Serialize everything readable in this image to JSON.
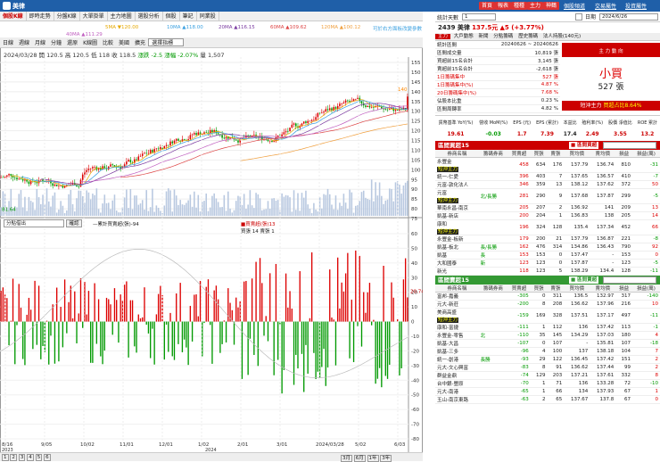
{
  "window": {
    "title": "美律",
    "buttons": [
      "首頁",
      "報表",
      "種種",
      "主力",
      "神鶴"
    ],
    "links": [
      "個股頻道",
      "交易屬性",
      "投資屬性"
    ]
  },
  "menu": [
    "個股K線",
    "即時走勢",
    "分盤K線",
    "大單掛單",
    "主力地圖",
    "選股分析",
    "個股",
    "筆記",
    "同業股"
  ],
  "ma": [
    {
      "label": "5MA",
      "value": "▼120.00",
      "color": "#e6a800"
    },
    {
      "label": "10MA",
      "value": "▲118.00",
      "color": "#3aa0e0"
    },
    {
      "label": "20MA",
      "value": "▲116.15",
      "color": "#7a3aa0"
    },
    {
      "label": "60MA",
      "value": "▲109.62",
      "color": "#d44"
    },
    {
      "label": "120MA",
      "value": "▲100.12",
      "color": "#f0a040"
    },
    {
      "label": "40MA",
      "value": "▲111.29",
      "color": "#c060c0"
    }
  ],
  "ma_note": "可於右方面板改變參數",
  "toolbar": [
    "日線",
    "週線",
    "月線",
    "分鐘",
    "還原",
    "K線圖",
    "比較",
    "美國",
    "擴充",
    "選擇指標"
  ],
  "ohlc": {
    "date": "2024/03/28",
    "open": "開 120.5",
    "high": "高 120.5",
    "low": "低 118",
    "close": "收 118.5",
    "change": "漲跌 -2.5",
    "pct": "漲幅 -2.07%",
    "volume": "量 1,507"
  },
  "price_axis": [
    "155",
    "150",
    "145",
    "140",
    "135",
    "130",
    "125",
    "120",
    "115",
    "110",
    "105",
    "100",
    "95",
    "90",
    "85",
    "80",
    "75"
  ],
  "price_high": "140",
  "price_low": "81.64",
  "lower_selector": "分點借出",
  "lower_btn": "確認",
  "lower_legend": "—累計買賣超(張)-94",
  "lower_legend2": "■買賣超(張)13",
  "lower_legend3": "買張 14  賣張 1",
  "lower_axis": [
    "60",
    "50",
    "40",
    "30",
    "20",
    "10",
    "0",
    "-10",
    "-20",
    "-30",
    "-40",
    "-50",
    "-60",
    "-70",
    "-80"
  ],
  "lower_mark": "20.74",
  "dates": [
    "8/16",
    "9/05",
    "10/02",
    "11/01",
    "12/01",
    "1/02",
    "2/01",
    "3/01",
    "2024/03/28",
    "5/02",
    "6/03"
  ],
  "years": [
    "2023",
    "2024"
  ],
  "bottom": {
    "pages": [
      "1",
      "2",
      "3",
      "4",
      "5",
      "6"
    ],
    "ranges": [
      "3月",
      "6月",
      "1年",
      "3年"
    ]
  },
  "right": {
    "select_label": "統計天數",
    "select_value": "1",
    "date_label": "日期",
    "date_value": "2024/6/26",
    "stock": "2439 美律",
    "price": "137.5元",
    "change": "▲5 (+3.77%)",
    "tabs": [
      "主力",
      "大戶動態",
      "新聞",
      "分點籌碼",
      "歷史籌碼",
      "法人持股(140元)"
    ],
    "stats": [
      [
        "統計區間",
        "20240626 ~ 20240626"
      ],
      [
        "區間成交量",
        "10,819 張"
      ],
      [
        "買超前15名合計",
        "3,145 張"
      ],
      [
        "賣超前15名合計",
        "-2,618 張"
      ],
      [
        "1日籌碼集中",
        "527 張"
      ],
      [
        "1日籌碼集中(%)",
        "4.87 %"
      ],
      [
        "20日籌碼集中(%)",
        "7.68 %"
      ],
      [
        "佔股本比重",
        "0.23 %"
      ],
      [
        "區間周轉率",
        "4.82 %"
      ]
    ],
    "direction_label": "主 力 動 向",
    "direction": "小買",
    "direction_val": "527 張",
    "short_label": "短沖主力",
    "short_val": "買超占比8.64%",
    "fund_headers": [
      "貨幣基準 YoY(%)",
      "營收 MoM(%)",
      "EPS (元)",
      "EPS (累計)",
      "本益比",
      "殖利率(%)",
      "股價 淨值比",
      "ROE 累計"
    ],
    "fund_values": [
      "19.61",
      "-0.03",
      "1.7",
      "7.39",
      "17.4",
      "2.49",
      "3.55",
      "13.2"
    ],
    "buy_title": "區間買超15",
    "buy_sel": "區間買超",
    "sell_title": "區間賣超15",
    "sell_sel": "區間賣超",
    "cols": [
      "券商名稱",
      "籌碼券商",
      "買賣超",
      "買張",
      "賣張",
      "買均價",
      "賣均價",
      "損益",
      "損益(萬)"
    ],
    "buy_rows": [
      [
        "永豐金",
        "短沖主力",
        "",
        "458",
        "634",
        "176",
        "137.79",
        "136.74",
        "810",
        "-31"
      ],
      [
        "統一-仁愛",
        "",
        "",
        "396",
        "403",
        "7",
        "137.65",
        "136.57",
        "410",
        "-7"
      ],
      [
        "元富-敦化法人",
        "",
        "",
        "346",
        "359",
        "13",
        "138.12",
        "137.62",
        "372",
        "50"
      ],
      [
        "元富",
        "短沖主力",
        "北/長勝",
        "281",
        "290",
        "9",
        "137.68",
        "137.87",
        "299",
        "-5"
      ],
      [
        "華南永昌-南京",
        "",
        "",
        "205",
        "207",
        "2",
        "136.92",
        "141",
        "209",
        "13"
      ],
      [
        "凱基-新店",
        "",
        "",
        "200",
        "204",
        "1",
        "136.83",
        "138",
        "205",
        "14"
      ],
      [
        "康和",
        "短沖主力",
        "",
        "196",
        "324",
        "128",
        "135.4",
        "137.34",
        "452",
        "66"
      ],
      [
        "永豐金-板新",
        "",
        "",
        "179",
        "200",
        "21",
        "137.79",
        "136.87",
        "221",
        "-8"
      ],
      [
        "凱基-板北",
        "",
        "長/長勝",
        "162",
        "476",
        "314",
        "134.86",
        "136.43",
        "790",
        "92"
      ],
      [
        "凱基",
        "",
        "長",
        "153",
        "153",
        "0",
        "137.47",
        "-",
        "153",
        "0"
      ],
      [
        "大和國泰",
        "",
        "新",
        "123",
        "123",
        "0",
        "137.87",
        "-",
        "123",
        "-5"
      ],
      [
        "新光",
        "",
        "",
        "118",
        "123",
        "5",
        "138.29",
        "134.4",
        "128",
        "-11"
      ]
    ],
    "sell_rows": [
      [
        "富邦-嘉義",
        "",
        "",
        "-305",
        "0",
        "311",
        "136.5",
        "132.97",
        "317",
        "-140"
      ],
      [
        "元大-新莊",
        "",
        "",
        "-200",
        "8",
        "208",
        "136.62",
        "137.96",
        "216",
        "10"
      ],
      [
        "美商高盛",
        "短沖主力",
        "",
        "-159",
        "169",
        "328",
        "137.51",
        "137.17",
        "497",
        "-11"
      ],
      [
        "康和-富捷",
        "",
        "",
        "-111",
        "1",
        "112",
        "136",
        "137.42",
        "113",
        "-1"
      ],
      [
        "永豐金-零售",
        "",
        "北",
        "-110",
        "35",
        "145",
        "134.29",
        "137.03",
        "180",
        "4"
      ],
      [
        "凱基-大昌",
        "",
        "",
        "-107",
        "0",
        "107",
        "-",
        "135.81",
        "107",
        "-18"
      ],
      [
        "凱基-三多",
        "",
        "",
        "-96",
        "4",
        "100",
        "137",
        "138.18",
        "104",
        "7"
      ],
      [
        "統一-創港",
        "",
        "長勝",
        "-93",
        "29",
        "122",
        "136.45",
        "137.42",
        "151",
        "2"
      ],
      [
        "元大-文心興富",
        "",
        "",
        "-83",
        "8",
        "91",
        "136.62",
        "137.44",
        "99",
        "2"
      ],
      [
        "群益金鼎",
        "",
        "",
        "-74",
        "129",
        "203",
        "137.21",
        "137.61",
        "332",
        "8"
      ],
      [
        "台中銀-豐原",
        "",
        "",
        "-70",
        "1",
        "71",
        "136",
        "133.28",
        "72",
        "-10"
      ],
      [
        "元大-南港",
        "",
        "",
        "-65",
        "1",
        "66",
        "134",
        "137.93",
        "67",
        "1"
      ],
      [
        "玉山-南京東路",
        "",
        "",
        "-63",
        "2",
        "65",
        "137.67",
        "137.8",
        "67",
        "0"
      ]
    ]
  }
}
